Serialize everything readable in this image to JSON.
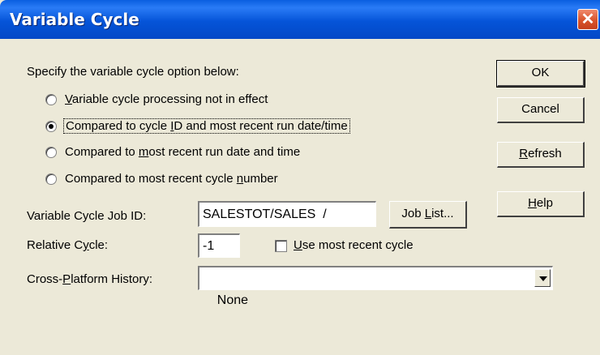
{
  "window": {
    "title": "Variable Cycle",
    "close_glyph": "✕"
  },
  "instruction": "Specify the variable cycle option below:",
  "options": [
    {
      "pre": "",
      "ul": "V",
      "post": "ariable cycle processing not in effect",
      "selected": false
    },
    {
      "pre": "Compared to cycle ",
      "ul": "I",
      "post": "D and most recent run date/time",
      "selected": true
    },
    {
      "pre": "Compared to ",
      "ul": "m",
      "post": "ost recent run date and time",
      "selected": false
    },
    {
      "pre": "Compared to most recent cycle ",
      "ul": "n",
      "post": "umber",
      "selected": false
    }
  ],
  "buttons": {
    "ok": {
      "pre": "",
      "ul": "",
      "post": "OK"
    },
    "cancel": {
      "pre": "",
      "ul": "",
      "post": "Cancel"
    },
    "refresh": {
      "pre": "",
      "ul": "R",
      "post": "efresh"
    },
    "help": {
      "pre": "",
      "ul": "H",
      "post": "elp"
    },
    "job_list": {
      "pre": "Job ",
      "ul": "L",
      "post": "ist..."
    }
  },
  "fields": {
    "job_id": {
      "label": "Variable Cycle Job ID:",
      "value": "SALESTOT/SALES  /"
    },
    "relative_cycle": {
      "label_pre": "Relative C",
      "label_ul": "y",
      "label_post": "cle:",
      "value": "-1"
    },
    "use_recent": {
      "pre": "",
      "ul": "U",
      "post": "se most recent cycle",
      "checked": false
    },
    "cross_platform": {
      "label_pre": "Cross-",
      "label_ul": "P",
      "label_post": "latform History:",
      "value": "None"
    }
  }
}
